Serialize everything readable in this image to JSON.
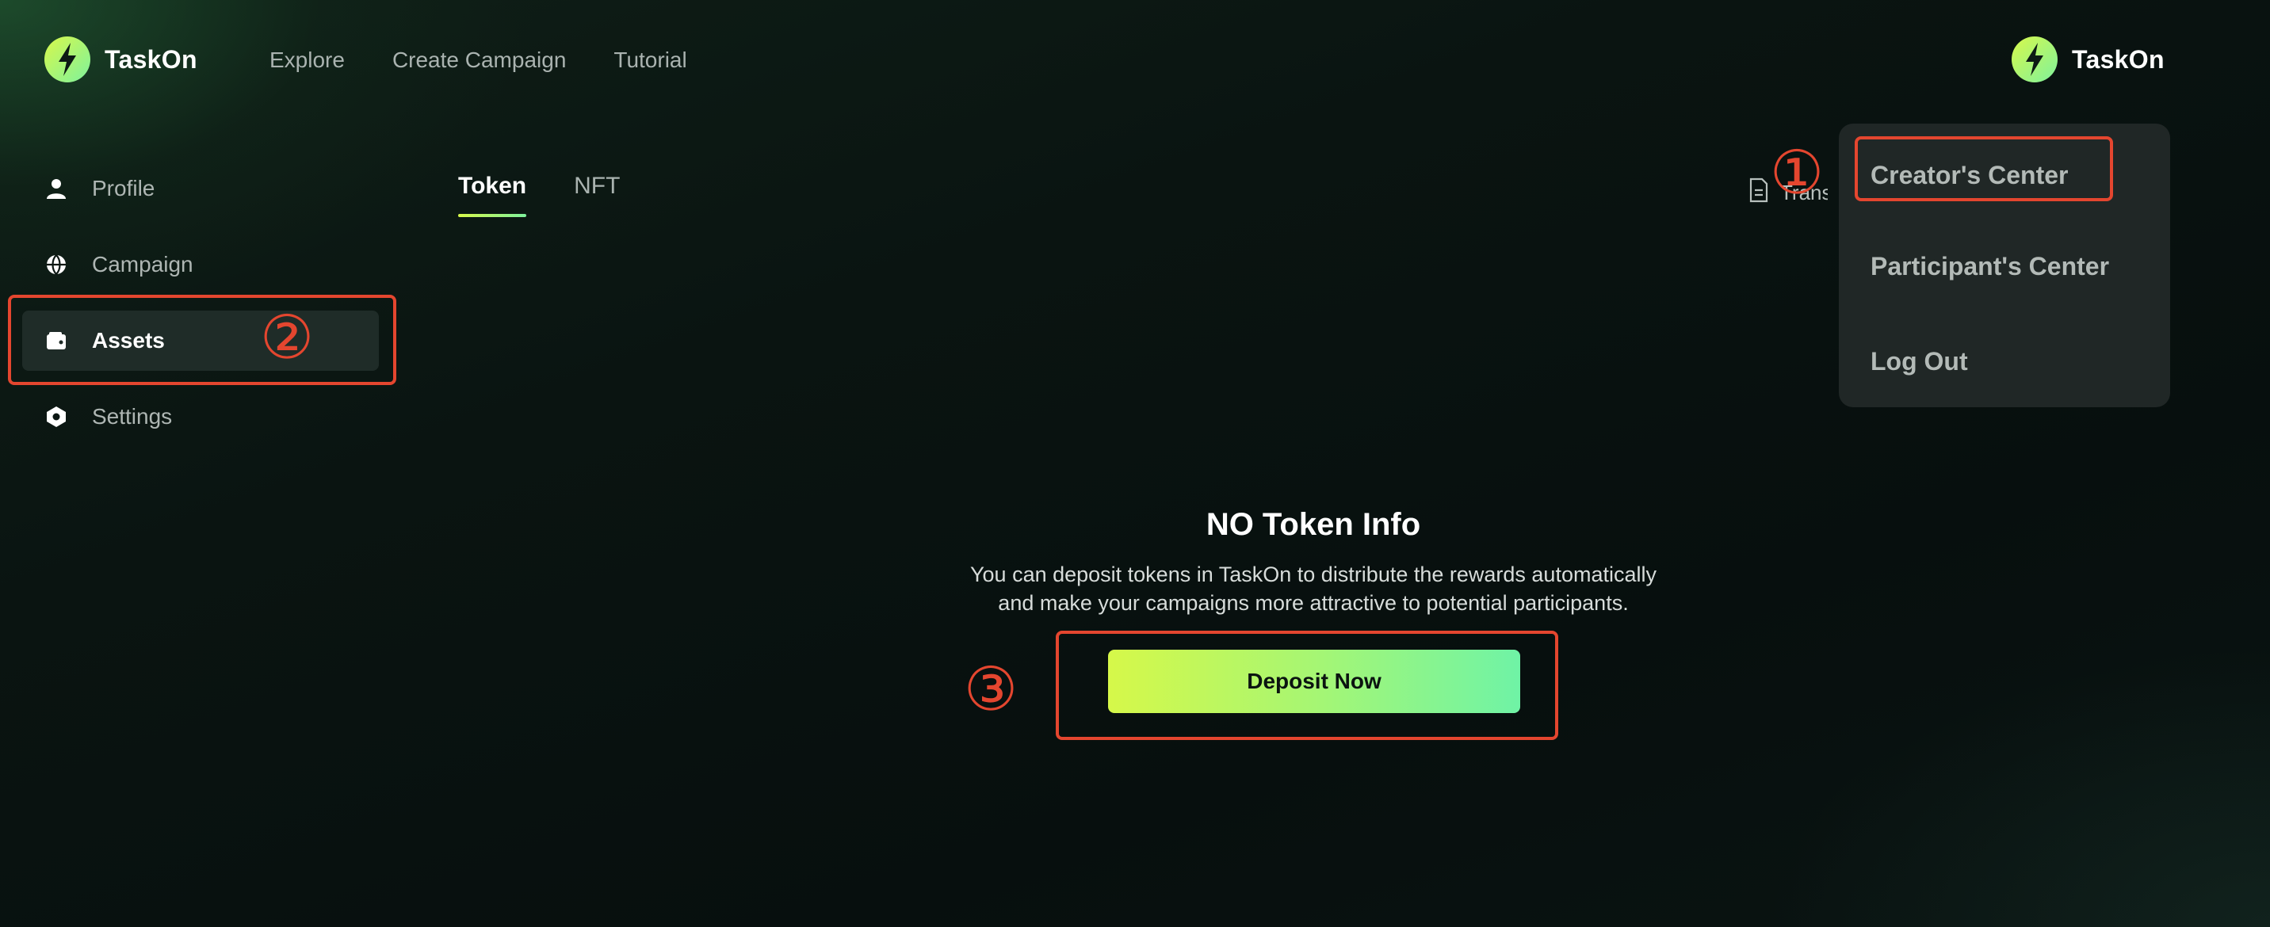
{
  "brand": {
    "name": "TaskOn",
    "accent_start": "#d8f84a",
    "accent_end": "#7ef29d"
  },
  "nav": {
    "items": [
      "Explore",
      "Create Campaign",
      "Tutorial"
    ]
  },
  "account": {
    "name": "TaskOn"
  },
  "sidebar": {
    "items": [
      {
        "label": "Profile",
        "icon": "person-icon"
      },
      {
        "label": "Campaign",
        "icon": "globe-icon"
      },
      {
        "label": "Assets",
        "icon": "wallet-icon",
        "active": true
      },
      {
        "label": "Settings",
        "icon": "hexagon-gear-icon"
      }
    ]
  },
  "tabs": [
    {
      "label": "Token",
      "active": true
    },
    {
      "label": "NFT"
    }
  ],
  "transactions_link": {
    "label": "Transactions",
    "icon": "document-icon"
  },
  "dropdown": {
    "items": [
      "Creator's Center",
      "Participant's Center",
      "Log Out"
    ]
  },
  "empty_state": {
    "title": "NO Token Info",
    "line1": "You can deposit tokens in TaskOn to distribute the rewards automatically",
    "line2": "and make your campaigns more attractive to potential participants."
  },
  "deposit": {
    "label": "Deposit Now"
  },
  "annotations": {
    "color": "#e4462f",
    "step1": "①",
    "step2": "②",
    "step3": "③"
  }
}
